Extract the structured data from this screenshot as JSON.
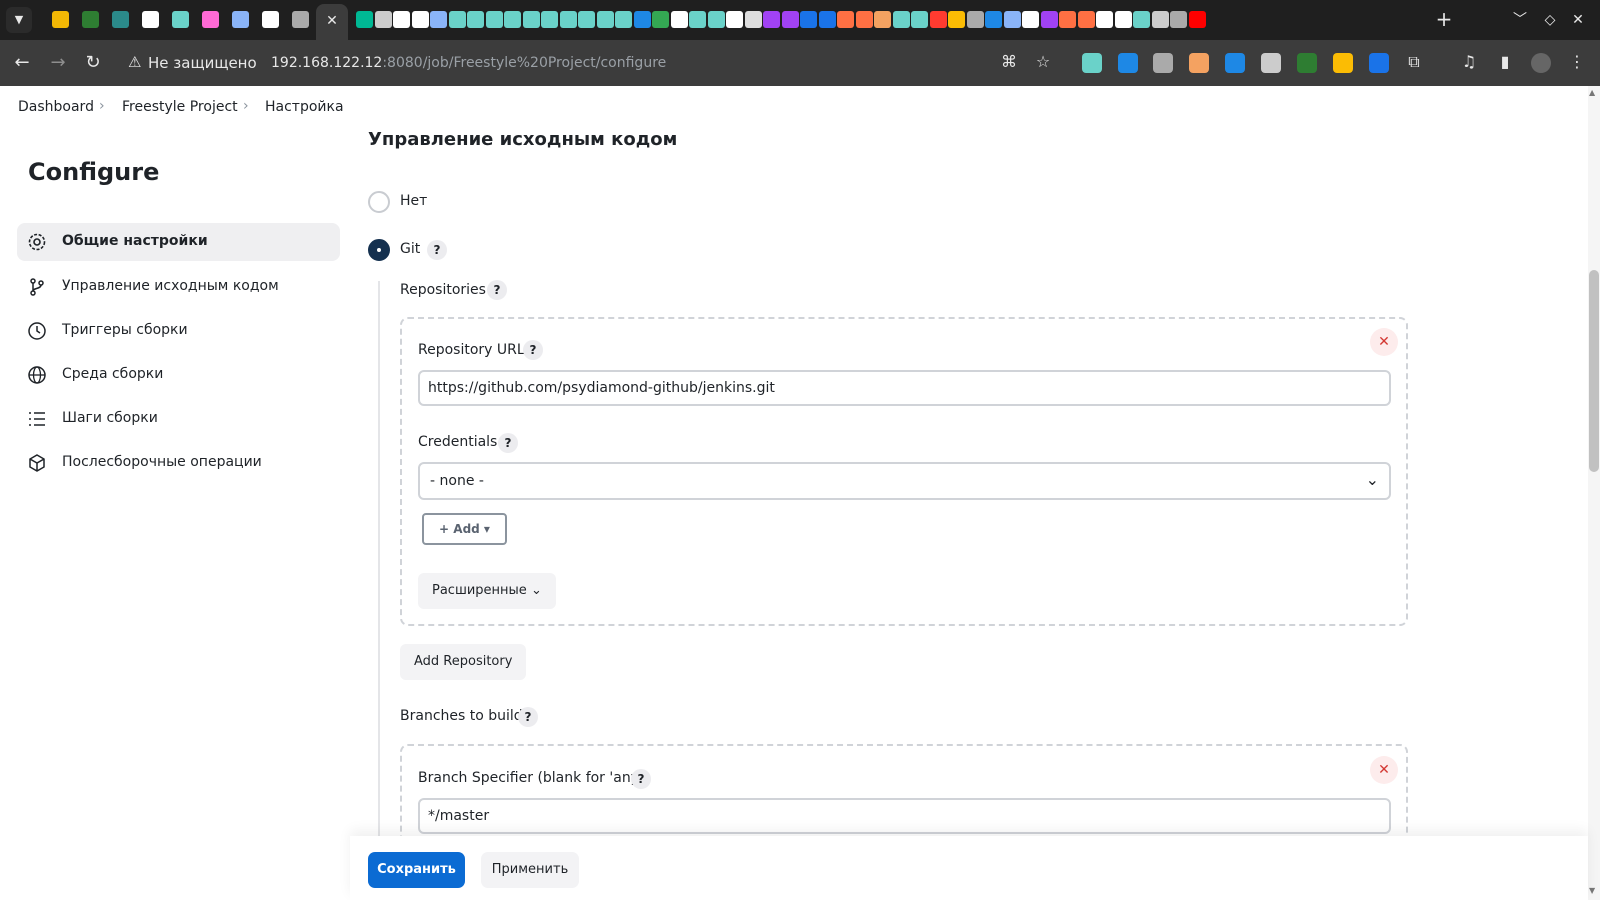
{
  "browser": {
    "active_tab_close": "✕",
    "new_tab": "+",
    "security_label": "Не защищено",
    "url_host": "192.168.122.12",
    "url_rest": ":8080/job/Freestyle%20Project/configure",
    "favicon_colors": [
      "#f2b705",
      "#2e7d32",
      "#2b8a8a",
      "#ffffff",
      "#6ad2c9",
      "#ff6ad5",
      "#8ab4f8",
      "#ffffff",
      "#aaaaaa",
      "#00b894",
      "#cccccc",
      "#ffffff",
      "#ffffff",
      "#8ab4f8",
      "#6ad2c9",
      "#6ad2c9",
      "#6ad2c9",
      "#6ad2c9",
      "#6ad2c9",
      "#6ad2c9",
      "#6ad2c9",
      "#6ad2c9",
      "#6ad2c9",
      "#6ad2c9",
      "#1e88e5",
      "#34a853",
      "#ffffff",
      "#6ad2c9",
      "#6ad2c9",
      "#ffffff",
      "#dddddd",
      "#a142f4",
      "#a142f4",
      "#1a73e8",
      "#1a73e8",
      "#ff7043",
      "#ff7043",
      "#f4a261",
      "#6ad2c9",
      "#6ad2c9",
      "#ff3b30",
      "#fbbc04",
      "#aaaaaa",
      "#1e88e5",
      "#8ab4f8",
      "#ffffff",
      "#a142f4",
      "#ff7043",
      "#ff7043",
      "#ffffff",
      "#ffffff",
      "#6ad2c9",
      "#cccccc",
      "#aaaaaa",
      "#ff0000"
    ]
  },
  "breadcrumbs": {
    "items": [
      "Dashboard",
      "Freestyle Project",
      "Настройка"
    ]
  },
  "sidebar": {
    "title": "Configure",
    "items": [
      {
        "label": "Общие настройки",
        "icon": "gear-icon"
      },
      {
        "label": "Управление исходным кодом",
        "icon": "git-branch-icon"
      },
      {
        "label": "Триггеры сборки",
        "icon": "clock-icon"
      },
      {
        "label": "Среда сборки",
        "icon": "globe-icon"
      },
      {
        "label": "Шаги сборки",
        "icon": "list-icon"
      },
      {
        "label": "Послесборочные операции",
        "icon": "package-icon"
      }
    ]
  },
  "scm": {
    "title": "Управление исходным кодом",
    "option_none": "Нет",
    "option_git": "Git",
    "selected": "Git",
    "repositories_label": "Repositories",
    "repo_url_label": "Repository URL",
    "repo_url_value": "https://github.com/psydiamond-github/jenkins.git",
    "credentials_label": "Credentials",
    "credentials_value": "- none -",
    "add_label": "+ Add ▾",
    "advanced_label": "Расширенные",
    "add_repository_label": "Add Repository",
    "branches_label": "Branches to build",
    "branch_specifier_label": "Branch Specifier (blank for 'any')",
    "branch_specifier_value": "*/master",
    "help_glyph": "?",
    "remove_glyph": "✕"
  },
  "actions": {
    "save": "Сохранить",
    "apply": "Применить"
  },
  "colors": {
    "primary": "#0b6bd3",
    "radio_checked": "#14304f",
    "remove": "#d33833"
  }
}
